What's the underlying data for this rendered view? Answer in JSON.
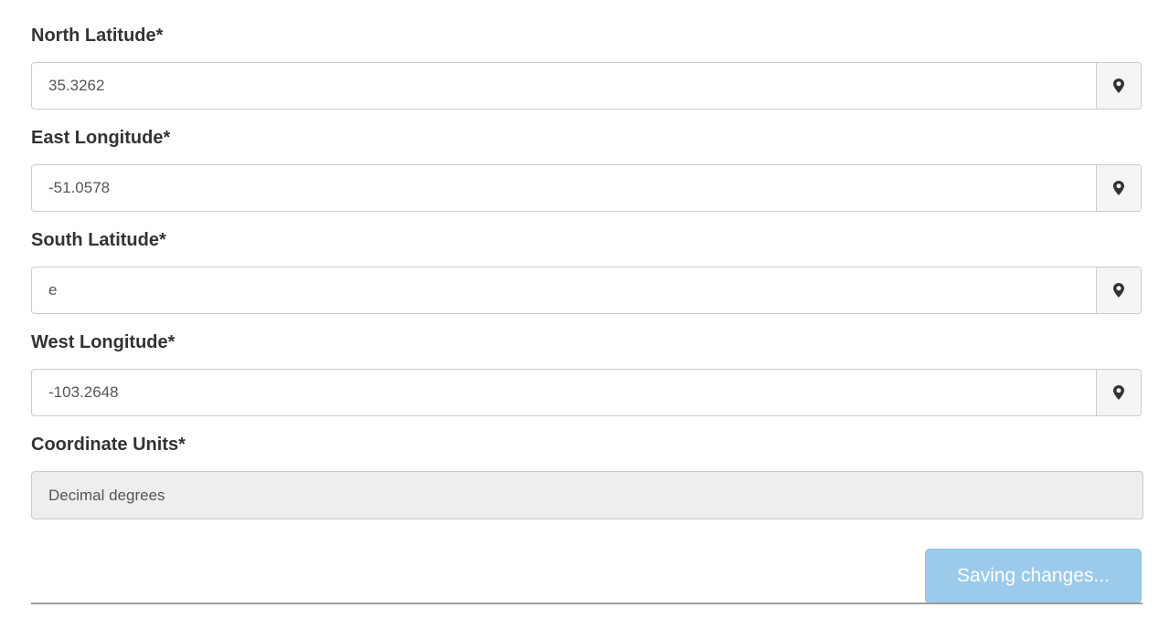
{
  "fields": [
    {
      "label": "North Latitude*",
      "value": "35.3262",
      "icon": "map-marker-icon"
    },
    {
      "label": "East Longitude*",
      "value": "-51.0578",
      "icon": "map-marker-icon"
    },
    {
      "label": "South Latitude*",
      "value": "e",
      "icon": "map-marker-icon"
    },
    {
      "label": "West Longitude*",
      "value": "-103.2648",
      "icon": "map-marker-icon"
    }
  ],
  "coordinate_units": {
    "label": "Coordinate Units*",
    "value": "Decimal degrees"
  },
  "save_button": {
    "label": "Saving changes..."
  },
  "colors": {
    "button_disabled_bg": "#9ccaea",
    "readonly_bg": "#eeeeee",
    "border": "#cccccc"
  }
}
